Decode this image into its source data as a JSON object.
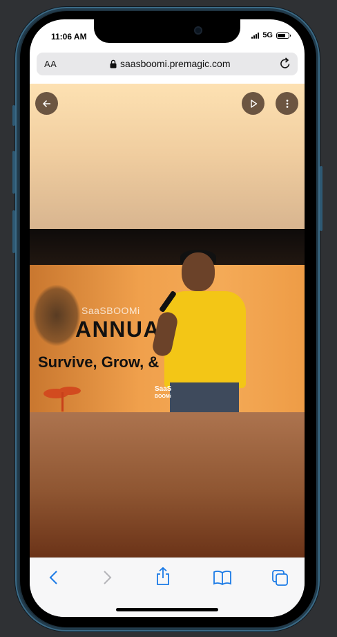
{
  "status_bar": {
    "time": "11:06 AM",
    "network": "5G"
  },
  "browser": {
    "text_size_label": "AA",
    "url": "saasboomi.premagic.com"
  },
  "photo": {
    "brand_small": "SaaSBOOMi",
    "brand_big": "ANNUAL",
    "tagline": "Survive, Grow, &",
    "logo_text_1": "SaaS",
    "logo_text_2": "BOOMi"
  },
  "controls": {
    "back_icon": "arrow-left-icon",
    "play_icon": "play-icon",
    "more_icon": "more-vertical-icon"
  },
  "toolbar": {
    "items": [
      "back-icon",
      "forward-icon",
      "share-icon",
      "bookmarks-icon",
      "tabs-icon"
    ]
  },
  "colors": {
    "accent": "#1a7ae6",
    "disabled": "#b4b4b8"
  }
}
